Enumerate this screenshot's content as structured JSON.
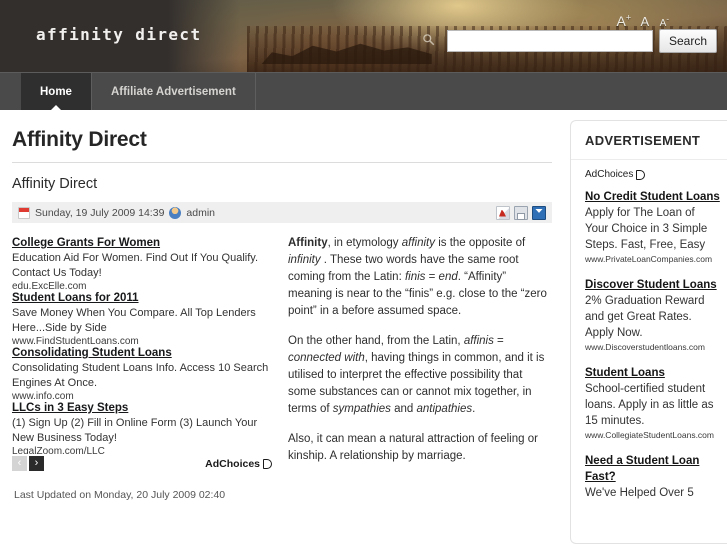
{
  "header": {
    "logo": "affinity direct",
    "font_sizer": {
      "increase": "A",
      "increase_sup": "+",
      "normal": "A",
      "decrease": "A",
      "decrease_sup": "-"
    },
    "search": {
      "value": "",
      "placeholder": "",
      "button_label": "Search",
      "icon": "search-icon"
    }
  },
  "nav": {
    "items": [
      {
        "label": "Home",
        "active": true
      },
      {
        "label": "Affiliate Advertisement",
        "active": false
      }
    ]
  },
  "main": {
    "page_title": "Affinity Direct",
    "article_title": "Affinity Direct",
    "meta": {
      "date": "Sunday, 19 July 2009 14:39",
      "author": "admin",
      "calendar_icon": "calendar-icon",
      "user_icon": "user-icon",
      "actions": [
        "pdf-icon",
        "print-icon",
        "email-icon"
      ]
    },
    "inline_ads": {
      "adchoices_label": "AdChoices",
      "prev_label": "‹",
      "next_label": "›",
      "units": [
        {
          "title": "College Grants For Women",
          "desc": "Education Aid For Women. Find Out If You Qualify. Contact Us Today!",
          "url": "edu.ExcElle.com"
        },
        {
          "title": "Student Loans for 2011",
          "desc": "Save Money When You Compare. All Top Lenders Here...Side by Side",
          "url": "www.FindStudentLoans.com"
        },
        {
          "title": "Consolidating Student Loans",
          "desc": "Consolidating Student Loans Info. Access 10 Search Engines At Once.",
          "url": "www.info.com"
        },
        {
          "title": "LLCs in 3 Easy Steps",
          "desc": "(1) Sign Up (2) Fill in Online Form (3) Launch Your New Business Today!",
          "url": "LegalZoom.com/LLC"
        }
      ]
    },
    "paragraphs": {
      "p1_lead": "Affinity",
      "p1_a": ", in etymology ",
      "p1_i1": "affinity",
      "p1_b": " is the opposite of ",
      "p1_i2": "infinity",
      "p1_c": " . These two words have the same root coming from the Latin: ",
      "p1_i3": "finis",
      "p1_d": " = ",
      "p1_i4": "end",
      "p1_e": ". “Affinity” meaning is near to the “finis” e.g. close to the “zero point” in a before assumed space.",
      "p2_a": "On the other hand, from the Latin, ",
      "p2_i1": "affinis",
      "p2_b": " = ",
      "p2_i2": "connected with",
      "p2_c": ", having things in common, and it is utilised to interpret the effective possibility that some substances can or cannot mix together, in terms of ",
      "p2_i3": "sympathies",
      "p2_d": " and ",
      "p2_i4": "antipathies",
      "p2_e": ".",
      "p3": "Also, it can mean a natural attraction of feeling or kinship. A relationship by marriage."
    },
    "last_updated": "Last Updated on Monday, 20 July 2009 02:40"
  },
  "sidebar": {
    "heading": "ADVERTISEMENT",
    "adchoices_label": "AdChoices",
    "units": [
      {
        "title": "No Credit Student Loans",
        "desc": "Apply for The Loan of\nYour Choice in 3 Simple\nSteps. Fast, Free, Easy",
        "url": "www.PrivateLoanCompanies.com"
      },
      {
        "title": "Discover Student Loans",
        "desc": "2% Graduation Reward\nand get Great Rates.\nApply Now.",
        "url": "www.Discoverstudentloans.com"
      },
      {
        "title": "Student Loans",
        "desc": "School-certified student\nloans. Apply in as little as\n15 minutes.",
        "url": "www.CollegiateStudentLoans.com"
      },
      {
        "title": "Need a Student Loan Fast?",
        "desc": "We've Helped Over 5",
        "url": ""
      }
    ]
  },
  "colors": {
    "header_bg": "#2f2d2b",
    "nav_bg": "#4a4a4a",
    "nav_active_bg": "#2f2f2f",
    "meta_bar_bg": "#efefef",
    "text": "#2e2e2e"
  }
}
